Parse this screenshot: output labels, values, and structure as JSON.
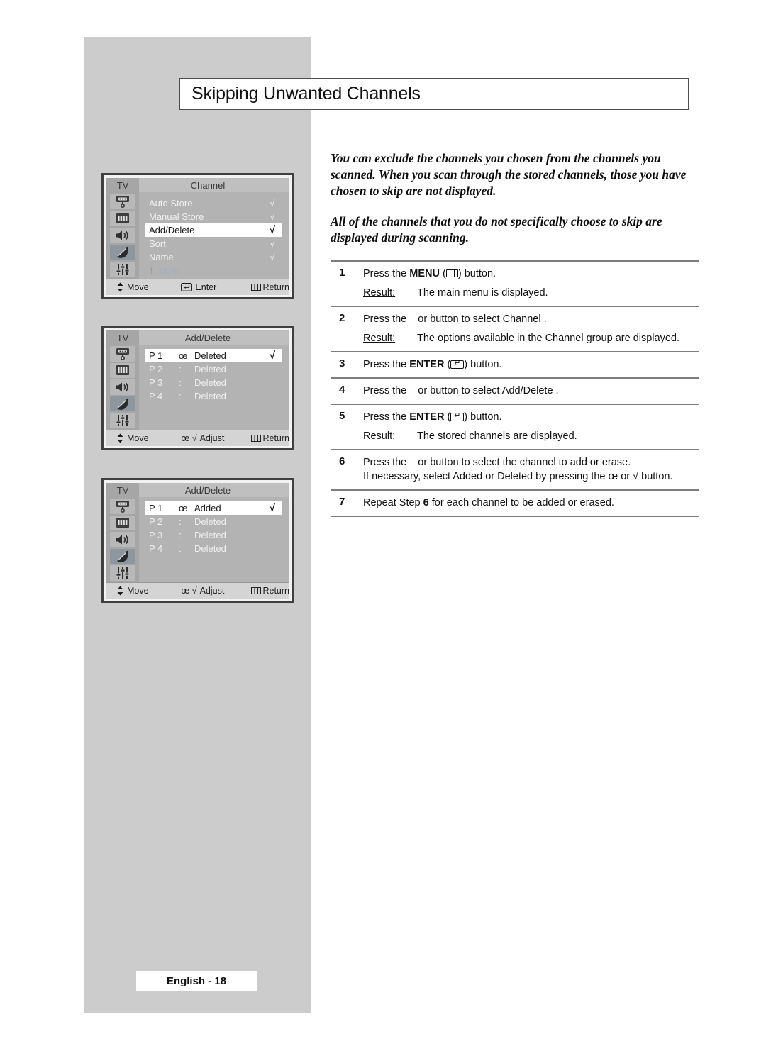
{
  "page": {
    "title": "Skipping Unwanted Channels",
    "footer": "English - 18"
  },
  "intro": {
    "paragraph1": "You can exclude the channels you chosen from the channels you scanned. When you scan through the stored channels, those you have chosen to skip are not displayed.",
    "paragraph2": "All of the channels that you do not specifically choose to skip are displayed during scanning."
  },
  "steps": [
    {
      "num": "1",
      "pre": "Press the ",
      "bold": "MENU",
      "post": " (",
      "key": "menu-key-icon",
      "tail": ") button.",
      "result_label": "Result:",
      "result_text": "The main menu is displayed."
    },
    {
      "num": "2",
      "pre": "Press the ",
      "bold": "",
      "post": "",
      "tail": "or    button to select Channel .",
      "result_label": "Result:",
      "result_text": "The options available in the Channel  group are displayed."
    },
    {
      "num": "3",
      "pre": "Press the ",
      "bold": "ENTER",
      "post": " (",
      "key": "enter-key-icon",
      "tail": ") button.",
      "result_label": "",
      "result_text": ""
    },
    {
      "num": "4",
      "pre": "Press the ",
      "bold": "",
      "post": "",
      "tail": "or    button to select  Add/Delete   .",
      "result_label": "",
      "result_text": ""
    },
    {
      "num": "5",
      "pre": "Press the ",
      "bold": "ENTER",
      "post": " (",
      "key": "enter-key-icon",
      "tail": ") button.",
      "result_label": "Result:",
      "result_text": "The stored channels are displayed."
    },
    {
      "num": "6",
      "pre": "Press the ",
      "bold": "",
      "post": "",
      "tail": "or    button to select the channel to add or erase.",
      "line2": "If necessary, select Added or Deleted   by pressing the œ or √ button.",
      "result_label": "",
      "result_text": ""
    },
    {
      "num": "7",
      "pre": "Repeat Step ",
      "bold": "6",
      "post": " for each channel to be added or erased.",
      "tail": "",
      "result_label": "",
      "result_text": ""
    }
  ],
  "osd_screens": [
    {
      "tv_tag": "TV",
      "title": "Channel",
      "icons": [
        "picture-icon",
        "picture-mode-icon",
        "sound-icon",
        "channel-dish-icon",
        "setup-sliders-icon"
      ],
      "selected_icon_index": 3,
      "rows": [
        {
          "label": "Auto Store",
          "check": "√",
          "highlight": false
        },
        {
          "label": "Manual Store",
          "check": "√",
          "highlight": false
        },
        {
          "label": "Add/Delete",
          "check": "√",
          "highlight": true
        },
        {
          "label": "Sort",
          "check": "√",
          "highlight": false
        },
        {
          "label": "Name",
          "check": "√",
          "highlight": false
        },
        {
          "label": "More",
          "check": "",
          "highlight": false,
          "more": true,
          "dagger": "†"
        }
      ],
      "bottom": {
        "move": "Move",
        "mid": "Enter",
        "mid_glyph": "enter-key-icon",
        "return": "Return"
      }
    },
    {
      "tv_tag": "TV",
      "title": "Add/Delete",
      "icons": [
        "picture-icon",
        "picture-mode-icon",
        "sound-icon",
        "channel-dish-icon",
        "setup-sliders-icon"
      ],
      "selected_icon_index": 3,
      "rows": [
        {
          "pnum": "P 1",
          "sep": "œ",
          "label": "Deleted",
          "check": "√",
          "highlight": true
        },
        {
          "pnum": "P 2",
          "sep": ":",
          "label": "Deleted",
          "check": "",
          "highlight": false
        },
        {
          "pnum": "P 3",
          "sep": ":",
          "label": "Deleted",
          "check": "",
          "highlight": false
        },
        {
          "pnum": "P 4",
          "sep": ":",
          "label": "Deleted",
          "check": "",
          "highlight": false
        }
      ],
      "bottom": {
        "move": "Move",
        "mid": "Adjust",
        "mid_glyph": "adjust-arrows",
        "mid_prefix": "œ √",
        "return": "Return"
      }
    },
    {
      "tv_tag": "TV",
      "title": "Add/Delete",
      "icons": [
        "picture-icon",
        "picture-mode-icon",
        "sound-icon",
        "channel-dish-icon",
        "setup-sliders-icon"
      ],
      "selected_icon_index": 3,
      "rows": [
        {
          "pnum": "P 1",
          "sep": "œ",
          "label": "Added",
          "check": "√",
          "highlight": true
        },
        {
          "pnum": "P 2",
          "sep": ":",
          "label": "Deleted",
          "check": "",
          "highlight": false
        },
        {
          "pnum": "P 3",
          "sep": ":",
          "label": "Deleted",
          "check": "",
          "highlight": false
        },
        {
          "pnum": "P 4",
          "sep": ":",
          "label": "Deleted",
          "check": "",
          "highlight": false
        }
      ],
      "bottom": {
        "move": "Move",
        "mid": "Adjust",
        "mid_glyph": "adjust-arrows",
        "mid_prefix": "œ √",
        "return": "Return"
      }
    }
  ],
  "colors": {
    "panel_gray": "#cccccc",
    "osd_body": "#b3b3b3",
    "osd_sidebar": "#a6a6a6",
    "osd_selected_icon": "#8e96a0",
    "highlight_row": "#ffffff",
    "rule": "#7d7d7d"
  }
}
